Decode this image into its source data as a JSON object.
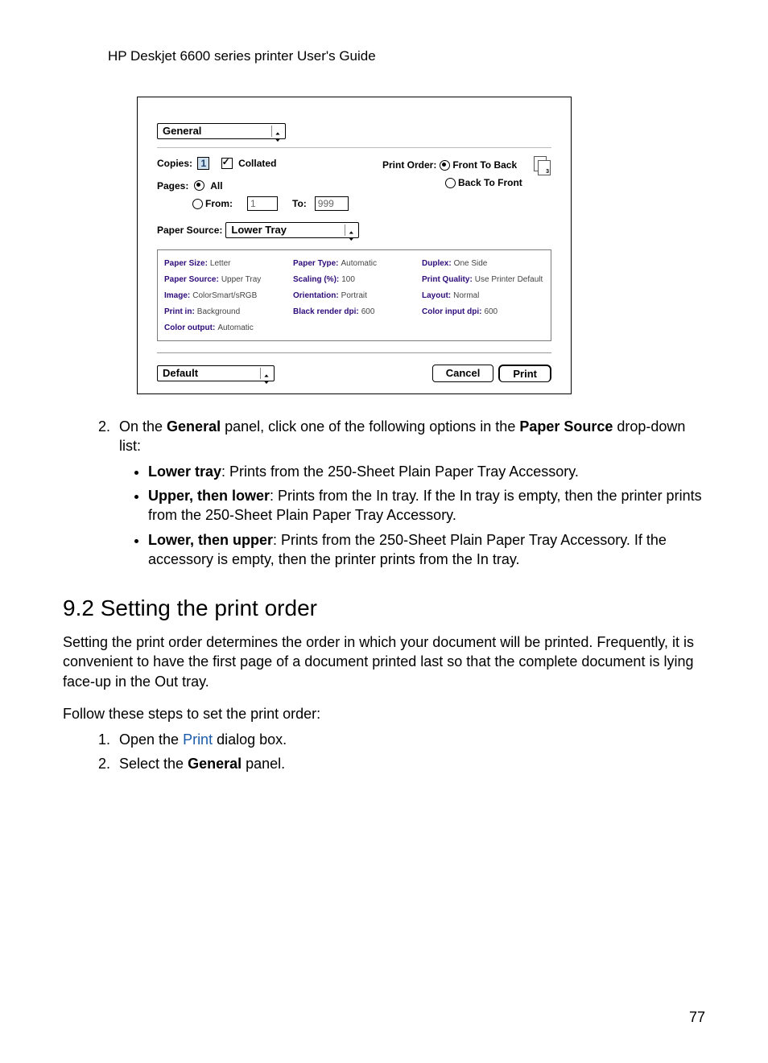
{
  "header": "HP Deskjet 6600 series printer User's Guide",
  "dialog": {
    "panel_select": "General",
    "copies_label": "Copies:",
    "copies_value": "1",
    "collated_label": "Collated",
    "print_order_label": "Print Order:",
    "front_to_back": "Front To Back",
    "back_to_front": "Back To Front",
    "pages_label": "Pages:",
    "pages_all": "All",
    "pages_from": "From:",
    "from_value": "1",
    "to_label": "To:",
    "to_value": "999",
    "paper_source_label": "Paper Source:",
    "paper_source_value": "Lower Tray",
    "summary": {
      "paper_size_l": "Paper Size:",
      "paper_size_v": "Letter",
      "paper_type_l": "Paper Type:",
      "paper_type_v": "Automatic",
      "duplex_l": "Duplex:",
      "duplex_v": "One Side",
      "paper_source_l": "Paper Source:",
      "paper_source_v": "Upper Tray",
      "scaling_l": "Scaling (%):",
      "scaling_v": "100",
      "print_quality_l": "Print Quality:",
      "print_quality_v": "Use Printer Default",
      "image_l": "Image:",
      "image_v": "ColorSmart/sRGB",
      "orientation_l": "Orientation:",
      "orientation_v": "Portrait",
      "layout_l": "Layout:",
      "layout_v": "Normal",
      "print_in_l": "Print in:",
      "print_in_v": "Background",
      "black_dpi_l": "Black render dpi:",
      "black_dpi_v": "600",
      "color_dpi_l": "Color input dpi:",
      "color_dpi_v": "600",
      "color_output_l": "Color output:",
      "color_output_v": "Automatic"
    },
    "preset_select": "Default",
    "cancel": "Cancel",
    "print": "Print"
  },
  "body": {
    "step2_a": "On the ",
    "step2_b": "General",
    "step2_c": " panel, click one of the following options in the ",
    "step2_d": "Paper Source",
    "step2_e": " drop-down list:",
    "opt1_a": "Lower tray",
    "opt1_b": ": Prints from the 250-Sheet Plain Paper Tray Accessory.",
    "opt2_a": "Upper, then lower",
    "opt2_b": ": Prints from the In tray. If the In tray is empty, then the printer prints from the 250-Sheet Plain Paper Tray Accessory.",
    "opt3_a": "Lower, then upper",
    "opt3_b": ": Prints from the 250-Sheet Plain Paper Tray Accessory. If the accessory is empty, then the printer prints from the In tray.",
    "heading": "9.2  Setting the print order",
    "para1": "Setting the print order determines the order in which your document will be printed. Frequently, it is convenient to have the first page of a document printed last so that the complete document is lying face-up in the Out tray.",
    "para2": "Follow these steps to set the print order:",
    "s1_a": "Open the ",
    "s1_link": "Print",
    "s1_b": " dialog box.",
    "s2_a": "Select the ",
    "s2_b": "General",
    "s2_c": " panel."
  },
  "page_number": "77"
}
